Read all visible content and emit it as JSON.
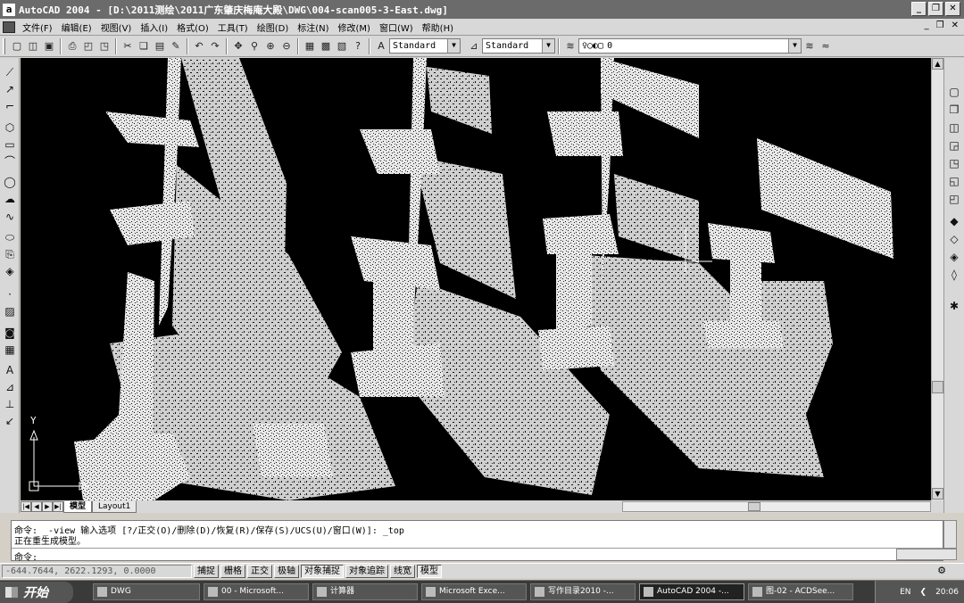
{
  "window": {
    "title": "AutoCAD 2004 - [D:\\2011测绘\\2011广东肇庆梅庵大殿\\DWG\\004-scan005-3-East.dwg]",
    "app_icon_glyph": "a"
  },
  "menu": {
    "items": [
      "文件(F)",
      "编辑(E)",
      "视图(V)",
      "插入(I)",
      "格式(O)",
      "工具(T)",
      "绘图(D)",
      "标注(N)",
      "修改(M)",
      "窗口(W)",
      "帮助(H)"
    ]
  },
  "toolbar": {
    "text_style": "Standard",
    "dim_style": "Standard",
    "layer": "0"
  },
  "tabs": {
    "model": "模型",
    "layout1": "Layout1"
  },
  "command": {
    "line1": "命令:  _-view 输入选项 [?/正交(O)/删除(D)/恢复(R)/保存(S)/UCS(U)/窗口(W)]: _top",
    "line2": "正在重生成模型。",
    "prompt": "命令:"
  },
  "status": {
    "coords": "-644.7644, 2622.1293, 0.0000",
    "buttons": [
      "捕捉",
      "栅格",
      "正交",
      "极轴",
      "对象捕捉",
      "对象追踪",
      "线宽",
      "模型"
    ],
    "active": [
      "对象捕捉",
      "模型"
    ]
  },
  "ucs": {
    "y_label": "Y"
  },
  "taskbar": {
    "start": "开始",
    "tasks": [
      {
        "label": "DWG",
        "active": false
      },
      {
        "label": "00 - Microsoft...",
        "active": false
      },
      {
        "label": "计算器",
        "active": false
      },
      {
        "label": "Microsoft Exce...",
        "active": false
      },
      {
        "label": "写作目录2010 -...",
        "active": false
      },
      {
        "label": "AutoCAD 2004 -...",
        "active": true
      },
      {
        "label": "图-02 - ACDSee...",
        "active": false
      }
    ],
    "lang": "EN",
    "clock": "20:06"
  }
}
